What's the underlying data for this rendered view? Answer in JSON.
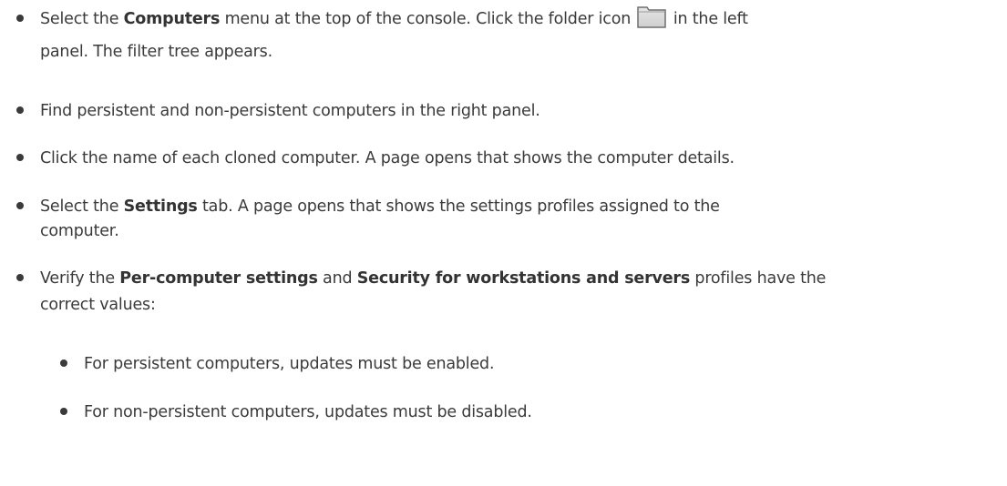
{
  "steps": [
    {
      "part1": "Select the ",
      "bold1": "Computers",
      "part2": " menu at the top of the console. Click the folder icon ",
      "folder_icon": "folder-icon",
      "part3": " in the left",
      "line2": "panel. The filter tree appears."
    },
    {
      "text": "Find persistent and non-persistent computers in the right panel."
    },
    {
      "text": "Click the name of each cloned computer. A page opens that shows the computer details."
    },
    {
      "part1": "Select the ",
      "bold1": "Settings",
      "part2": " tab. A page opens that shows the settings profiles assigned to the",
      "line2": "computer."
    },
    {
      "part1": "Verify the ",
      "bold1": "Per-computer settings",
      "part2": " and ",
      "bold2": "Security for workstations and servers",
      "part3": " profiles have the",
      "line2": "correct values:"
    }
  ],
  "substeps": [
    {
      "text": "For persistent computers, updates must be enabled."
    },
    {
      "text": "For non-persistent computers, updates must be disabled."
    }
  ]
}
